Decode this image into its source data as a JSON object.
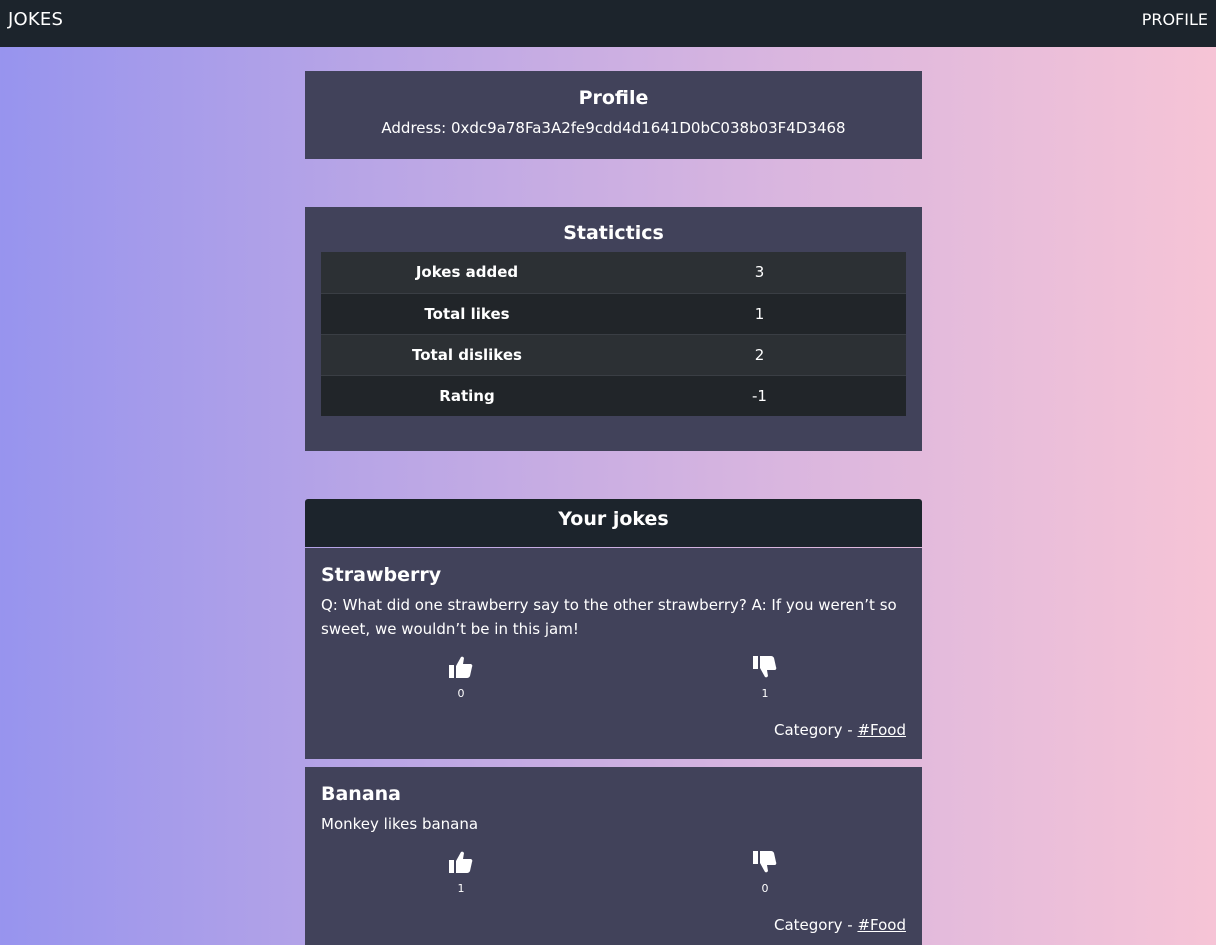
{
  "navbar": {
    "brand": "JOKES",
    "profile_link": "PROFILE"
  },
  "profile": {
    "title": "Profile",
    "address": "Address: 0xdc9a78Fa3A2fe9cdd4d1641D0bC038b03F4D3468"
  },
  "statistics": {
    "title": "Statictics",
    "rows": [
      {
        "label": "Jokes added",
        "value": "3"
      },
      {
        "label": "Total likes",
        "value": "1"
      },
      {
        "label": "Total dislikes",
        "value": "2"
      },
      {
        "label": "Rating",
        "value": "-1"
      }
    ]
  },
  "jokes_section": {
    "title": "Your jokes",
    "category_prefix": "Category - ",
    "jokes": [
      {
        "title": "Strawberry",
        "text": "Q: What did one strawberry say to the other strawberry? A: If you weren’t so sweet, we wouldn’t be in this jam!",
        "likes": "0",
        "dislikes": "1",
        "category": "#Food",
        "like_icon": "thumbs-up-icon",
        "dislike_icon": "thumbs-down-icon"
      },
      {
        "title": "Banana",
        "text": "Monkey likes banana",
        "likes": "1",
        "dislikes": "0",
        "category": "#Food",
        "like_icon": "thumbs-up-icon",
        "dislike_icon": "thumbs-down-icon"
      }
    ]
  },
  "colors": {
    "navbar_bg": "#1c242c",
    "card_bg": "#41425a",
    "gradient_start": "#9794ee",
    "gradient_end": "#f6c4d6"
  }
}
